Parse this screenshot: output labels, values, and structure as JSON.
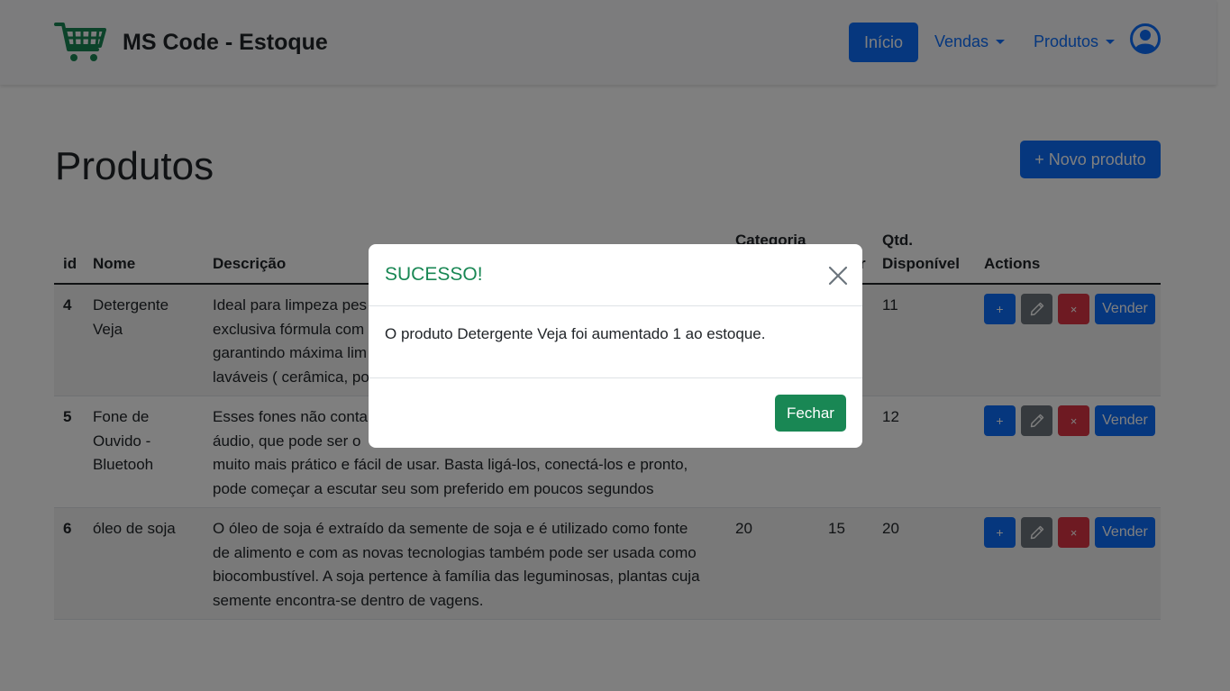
{
  "brand": {
    "title": "MS Code - Estoque",
    "icon": "shopping-cart-icon",
    "color": "#198754"
  },
  "nav": {
    "inicio": "Início",
    "vendas": "Vendas",
    "produtos": "Produtos",
    "avatar_icon": "user-circle-icon"
  },
  "page": {
    "title": "Produtos",
    "new_button": "+ Novo produto"
  },
  "table": {
    "headers": {
      "id": "id",
      "nome": "Nome",
      "descricao": "Descrição",
      "categoria": "Categoria",
      "preco_partial": "r",
      "qtd_line1": "Qtd.",
      "qtd_line2": "Disponível",
      "actions": "Actions"
    },
    "rows": [
      {
        "id": "4",
        "nome_l1": "Detergente",
        "nome_l2": "Veja",
        "desc_l1": "Ideal para limpeza pes",
        "desc_l2": "exclusiva fórmula com",
        "desc_l3": "garantindo máxima lim",
        "desc_l4": "laváveis ( cerâmica, po",
        "qtd": "11"
      },
      {
        "id": "5",
        "nome_l1": "Fone de",
        "nome_l2": "Ouvido -",
        "nome_l3": "Bluetooh",
        "desc_l1": "Esses fones não contar",
        "desc_l2": "áudio, que pode ser o",
        "desc_l3": "muito mais prático e fácil de usar. Basta ligá-los, conectá-los e pronto,",
        "desc_l4": "pode começar a escutar seu som preferido em poucos segundos",
        "qtd": "12"
      },
      {
        "id": "6",
        "nome_l1": "óleo de soja",
        "desc_l1": "O óleo de soja é extraído da semente de soja e é utilizado como fonte",
        "desc_l2": "de alimento e com as novas tecnologias também pode ser usada como",
        "desc_l3": "biocombustível. A soja pertence à família das leguminosas, plantas cuja",
        "desc_l4": "semente encontra-se dentro de vagens.",
        "categoria": "20",
        "preco": "15",
        "qtd": "20"
      }
    ],
    "action_labels": {
      "plus": "+",
      "delete": "×",
      "vender": "Vender"
    }
  },
  "modal": {
    "title": "SUCESSO!",
    "message": "O produto Detergente Veja foi aumentado 1 ao estoque.",
    "close_button": "Fechar"
  }
}
